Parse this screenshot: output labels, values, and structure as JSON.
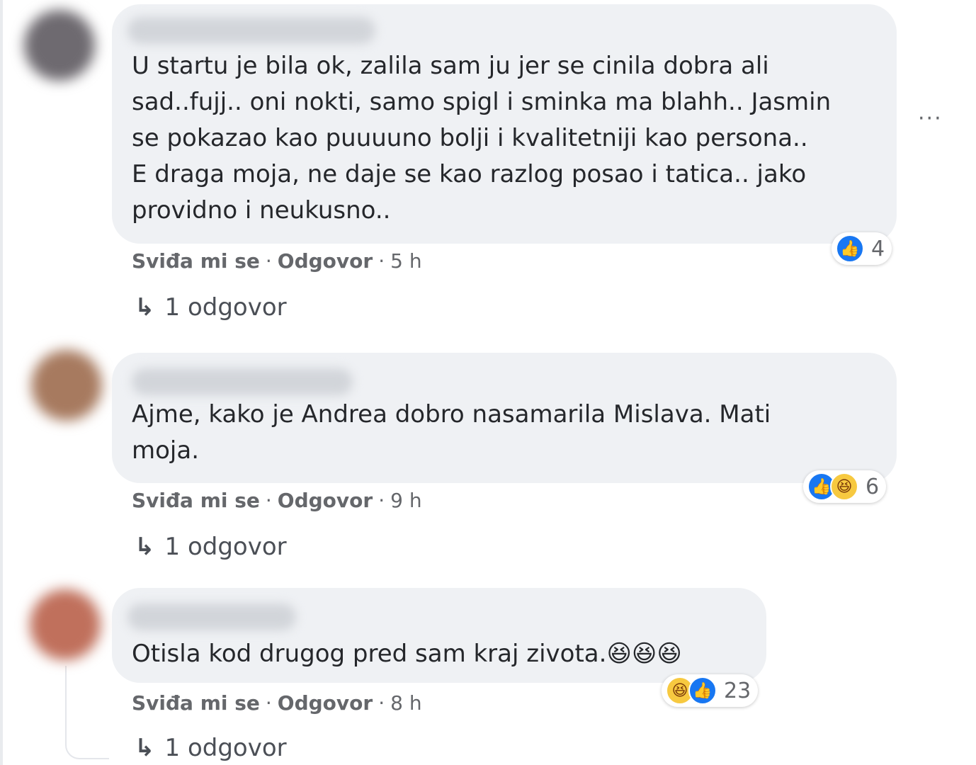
{
  "comments": [
    {
      "text": "U startu je bila ok, zalila sam ju jer se cinila dobra ali\nsad..fujj.. oni nokti, samo spigl i sminka ma blahh.. Jasmin\nse pokazao kao puuuuno bolji i kvalitetniji kao persona..\nE draga moja, ne daje se kao razlog posao i tatica.. jako\nprovidno i neukusno..",
      "reaction_icons": [
        "like-icon"
      ],
      "reaction_count": "4",
      "like_label": "Sviđa mi se",
      "separator": "·",
      "reply_label": "Odgovor",
      "time": "5 h",
      "replies_label": "1 odgovor",
      "avatar_color": "#6e6a70"
    },
    {
      "text": "Ajme, kako je Andrea dobro nasamarila Mislava. Mati\nmoja.",
      "reaction_icons": [
        "like-icon",
        "haha-icon"
      ],
      "reaction_count": "6",
      "like_label": "Sviđa mi se",
      "separator": "·",
      "reply_label": "Odgovor",
      "time": "9 h",
      "replies_label": "1 odgovor",
      "avatar_color": "#a77a5f"
    },
    {
      "text": "Otisla kod drugog pred sam kraj zivota.😆😆😆",
      "reaction_icons": [
        "haha-icon",
        "like-icon"
      ],
      "reaction_count": "23",
      "like_label": "Sviđa mi se",
      "separator": "·",
      "reply_label": "Odgovor",
      "time": "8 h",
      "replies_label": "1 odgovor",
      "avatar_color": "#c0705c"
    }
  ],
  "more_options_label": "···",
  "reply_arrow_glyph": "↳",
  "colors": {
    "like": "#1877f2",
    "haha": "#f7c940",
    "bubble": "#eff1f4"
  }
}
